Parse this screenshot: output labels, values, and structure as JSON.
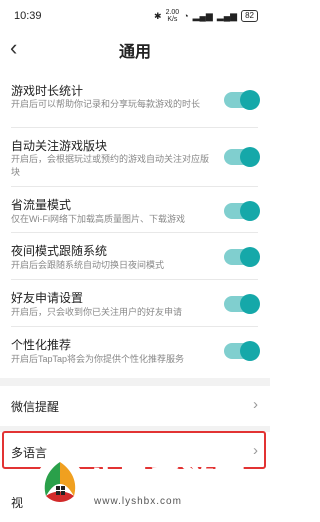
{
  "status_bar": {
    "time": "10:39",
    "network_speed": "2.00\nK/s",
    "battery": "82"
  },
  "header": {
    "back_icon": "chevron-left-icon",
    "title": "通用"
  },
  "settings": [
    {
      "title": "游戏时长统计",
      "desc": "开启后可以帮助你记录和分享玩每款游戏的时长",
      "enabled": true
    },
    {
      "title": "自动关注游戏版块",
      "desc": "开启后，会根据玩过或预约的游戏自动关注对应版块",
      "enabled": true
    },
    {
      "title": "省流量模式",
      "desc": "仅在Wi-Fi网络下加载高质量图片、下载游戏",
      "enabled": true
    },
    {
      "title": "夜间模式跟随系统",
      "desc": "开启后会跟随系统自动切换日夜间模式",
      "enabled": true
    },
    {
      "title": "好友申请设置",
      "desc": "开启后，只会收到你已关注用户的好友申请",
      "enabled": true
    },
    {
      "title": "个性化推荐",
      "desc": "开启后TapTap将会为你提供个性化推荐服务",
      "enabled": true
    }
  ],
  "nav_items": [
    {
      "label": "微信提醒"
    },
    {
      "label": "多语言"
    },
    {
      "label": "视"
    }
  ],
  "watermark": {
    "brand": "八星手游网",
    "url": "www.lyshbx.com"
  },
  "colors": {
    "toggle_on": "#15a8a9",
    "toggle_track": "#80cfcf",
    "highlight": "#e23333"
  }
}
